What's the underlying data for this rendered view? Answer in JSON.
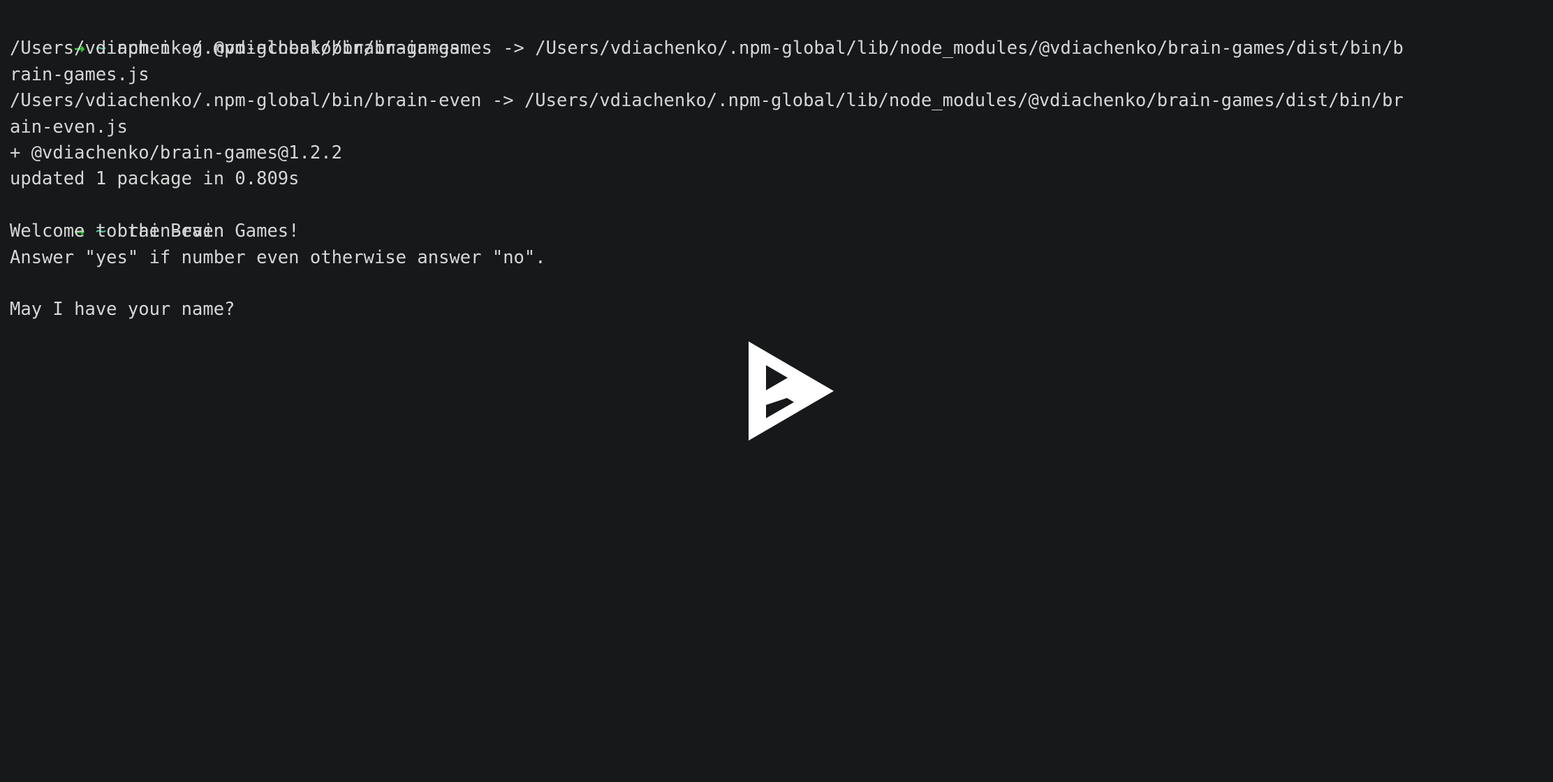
{
  "terminal": {
    "background_color": "#16181a",
    "foreground_color": "#d6d6d6",
    "prompt_arrow_color": "#35c635",
    "prompt_dir_color": "#52c9a0",
    "prompt_arrow": "→",
    "prompt_dir": "~",
    "lines": [
      {
        "type": "prompt",
        "arrow": "→",
        "dir": "~",
        "command": "npm i -g @vdiachenko/brain-games"
      },
      {
        "type": "output",
        "text": "/Users/vdiachenko/.npm-global/bin/brain-games -> /Users/vdiachenko/.npm-global/lib/node_modules/@vdiachenko/brain-games/dist/bin/b"
      },
      {
        "type": "output",
        "text": "rain-games.js"
      },
      {
        "type": "output",
        "text": "/Users/vdiachenko/.npm-global/bin/brain-even -> /Users/vdiachenko/.npm-global/lib/node_modules/@vdiachenko/brain-games/dist/bin/br"
      },
      {
        "type": "output",
        "text": "ain-even.js"
      },
      {
        "type": "output",
        "text": "+ @vdiachenko/brain-games@1.2.2"
      },
      {
        "type": "output",
        "text": "updated 1 package in 0.809s"
      },
      {
        "type": "prompt",
        "arrow": "→",
        "dir": "~",
        "command": "brain-even"
      },
      {
        "type": "output",
        "text": "Welcome to the Brain Games!"
      },
      {
        "type": "output",
        "text": "Answer \"yes\" if number even otherwise answer \"no\"."
      },
      {
        "type": "blank",
        "text": ""
      },
      {
        "type": "output",
        "text": "May I have your name?"
      }
    ]
  },
  "overlay": {
    "play_button": {
      "icon": "play-terminal-icon",
      "fill_color": "#ffffff",
      "cutout_color": "#16181a",
      "label": "Play"
    }
  }
}
